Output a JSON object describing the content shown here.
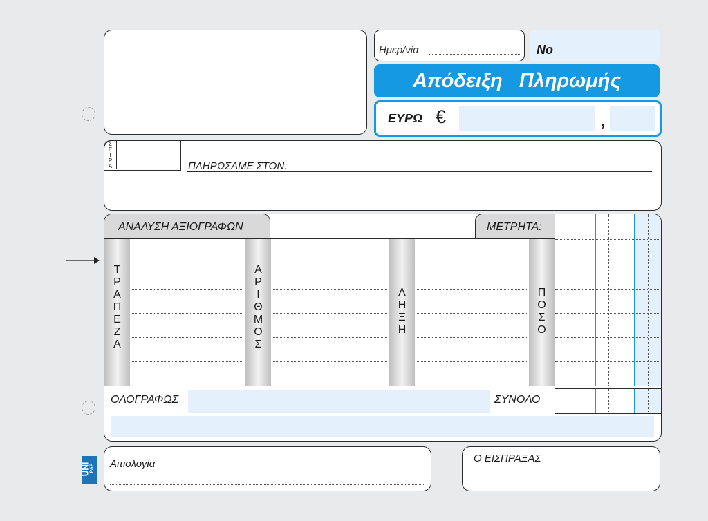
{
  "header": {
    "date_label": "Ημερ/νία",
    "no_label": "No",
    "title": "Απόδειξη   Πληρωμής",
    "currency_label": "ΕΥΡΩ",
    "currency_symbol": "€",
    "decimal_separator": ","
  },
  "series": {
    "label_letters": [
      "Σ",
      "Ε",
      "Ι",
      "Ρ",
      "Α"
    ]
  },
  "payee": {
    "label": "ΠΛΗΡΩΣΑΜΕ ΣΤΟΝ:"
  },
  "analysis": {
    "title": "ΑΝΑΛΥΣΗ ΑΞΙΟΓΡΑΦΩΝ",
    "cash_label": "ΜΕΤΡΗΤΑ:",
    "columns": [
      {
        "name": "bank",
        "letters": [
          "Τ",
          "Ρ",
          "Α",
          "Π",
          "Ε",
          "Ζ",
          "Α"
        ]
      },
      {
        "name": "number",
        "letters": [
          "Α",
          "Ρ",
          "Ι",
          "Θ",
          "Μ",
          "Ο",
          "Σ"
        ]
      },
      {
        "name": "maturity",
        "letters": [
          "Λ",
          "Η",
          "Ξ",
          "Η"
        ]
      },
      {
        "name": "amount",
        "letters": [
          "Π",
          "Ο",
          "Σ",
          "Ο"
        ]
      }
    ],
    "in_words_label": "ΟΛΟΓΡΑΦΩΣ",
    "total_label": "ΣΥΝΟΛΟ"
  },
  "footer": {
    "reason_label": "Αιτιολογία",
    "collector_label": "Ο ΕΙΣΠΡΑΞΑΣ",
    "brand_top": "UNI",
    "brand_bottom": "PAP"
  },
  "colors": {
    "accent": "#1599e0",
    "light_blue": "#e4f0fb",
    "border": "#2b2b2b"
  }
}
